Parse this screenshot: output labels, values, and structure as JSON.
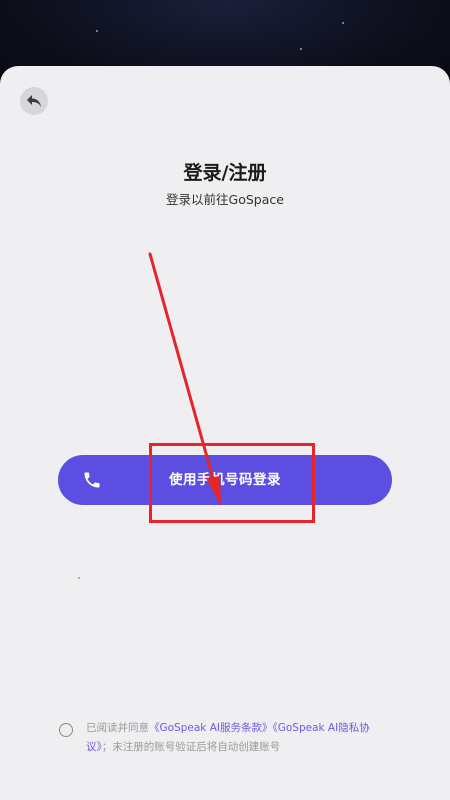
{
  "header": {
    "back_icon": "back-arrow-icon",
    "title": "登录/注册",
    "subtitle": "登录以前往GoSpace"
  },
  "login": {
    "phone_button_label": "使用手机号码登录",
    "phone_icon": "phone-icon",
    "accent_color": "#5b4ee0"
  },
  "agreement": {
    "prefix": "已阅读并同意",
    "terms_link": "《GoSpeak AI服务条款》",
    "privacy_link": "《GoSpeak AI隐私协议》",
    "suffix": "；未注册的账号验证后将自动创建账号",
    "link_color": "#6b5ce6"
  },
  "annotation": {
    "highlight_color": "#e5252a"
  }
}
